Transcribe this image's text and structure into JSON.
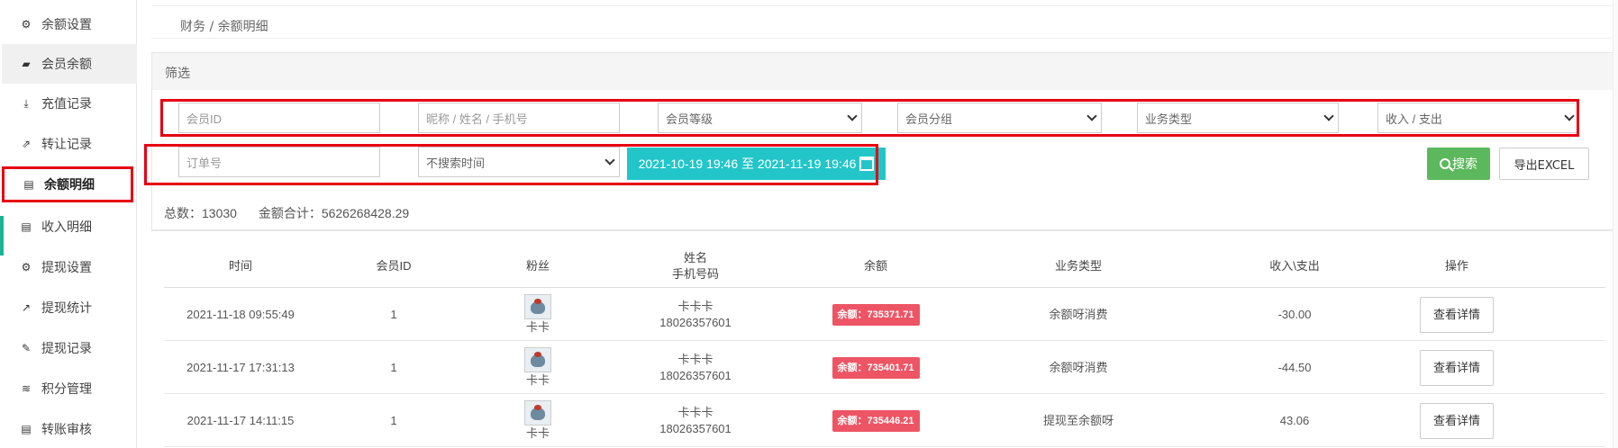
{
  "sidebar": {
    "items": [
      {
        "label": "余额设置",
        "icon": "gear-icon",
        "glyph": "⚙"
      },
      {
        "label": "会员余额",
        "icon": "book-icon",
        "glyph": "▰"
      },
      {
        "label": "充值记录",
        "icon": "download-icon",
        "glyph": "⤓"
      },
      {
        "label": "转让记录",
        "icon": "external-link-icon",
        "glyph": "⇗"
      },
      {
        "label": "余额明细",
        "icon": "document-icon",
        "glyph": "▤"
      },
      {
        "label": "收入明细",
        "icon": "document-icon",
        "glyph": "▤"
      },
      {
        "label": "提现设置",
        "icon": "gear-icon",
        "glyph": "⚙"
      },
      {
        "label": "提现统计",
        "icon": "line-chart-icon",
        "glyph": "↗"
      },
      {
        "label": "提现记录",
        "icon": "pencil-icon",
        "glyph": "✎"
      },
      {
        "label": "积分管理",
        "icon": "database-icon",
        "glyph": "≋"
      },
      {
        "label": "转账审核",
        "icon": "document-icon",
        "glyph": "▤"
      }
    ]
  },
  "breadcrumb": "财务 / 余额明细",
  "filter": {
    "title": "筛选",
    "member_id_placeholder": "会员ID",
    "name_placeholder": "昵称 / 姓名 / 手机号",
    "member_level": "会员等级",
    "member_group": "会员分组",
    "business_type": "业务类型",
    "income_expense": "收入 / 支出",
    "order_placeholder": "订单号",
    "time_search": "不搜索时间",
    "date_range": "2021-10-19 19:46 至 2021-11-19 19:46",
    "search_label": "搜索",
    "export_label": "导出EXCEL"
  },
  "stats": {
    "total_label": "总数：",
    "total_value": "13030",
    "sum_label": "金额合计：",
    "sum_value": "5626268428.29"
  },
  "table": {
    "headers": {
      "time": "时间",
      "member_id": "会员ID",
      "fans": "粉丝",
      "name": "姓名",
      "phone": "手机号码",
      "balance": "余额",
      "business_type": "业务类型",
      "income_expense": "收入\\支出",
      "action": "操作"
    },
    "rows": [
      {
        "time": "2021-11-18 09:55:49",
        "member_id": "1",
        "fans": "卡卡",
        "name": "卡卡卡",
        "phone": "18026357601",
        "balance": "余额：735371.71",
        "business_type": "余额呀消费",
        "amount": "-30.00",
        "action": "查看详情"
      },
      {
        "time": "2021-11-17 17:31:13",
        "member_id": "1",
        "fans": "卡卡",
        "name": "卡卡卡",
        "phone": "18026357601",
        "balance": "余额：735401.71",
        "business_type": "余额呀消费",
        "amount": "-44.50",
        "action": "查看详情"
      },
      {
        "time": "2021-11-17 14:11:15",
        "member_id": "1",
        "fans": "卡卡",
        "name": "卡卡卡",
        "phone": "18026357601",
        "balance": "余额：735446.21",
        "business_type": "提现至余额呀",
        "amount": "43.06",
        "action": "查看详情"
      }
    ]
  },
  "colors": {
    "highlight_red": "#e60012",
    "date_button": "#23c6c8",
    "search_button": "#5cb85c",
    "balance_badge": "#ed5565",
    "active_marker": "#1ab394"
  }
}
